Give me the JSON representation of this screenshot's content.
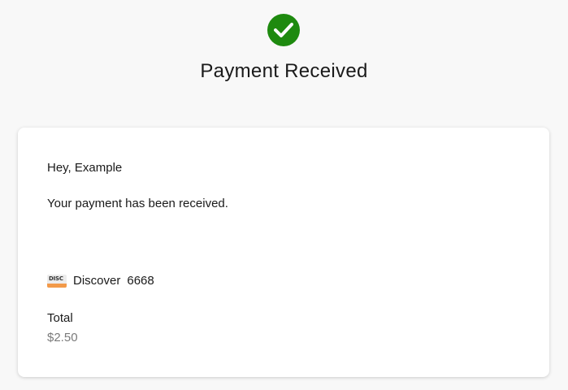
{
  "header": {
    "status_icon": "check-circle-icon",
    "title": "Payment Received",
    "accent_color": "#1e8a0f"
  },
  "card": {
    "greeting": "Hey, Example",
    "message": "Your payment has been received.",
    "payment_method": {
      "logo_text": "DISC",
      "brand": "Discover",
      "last4": "6668"
    },
    "total_label": "Total",
    "total_value": "$2.50"
  }
}
